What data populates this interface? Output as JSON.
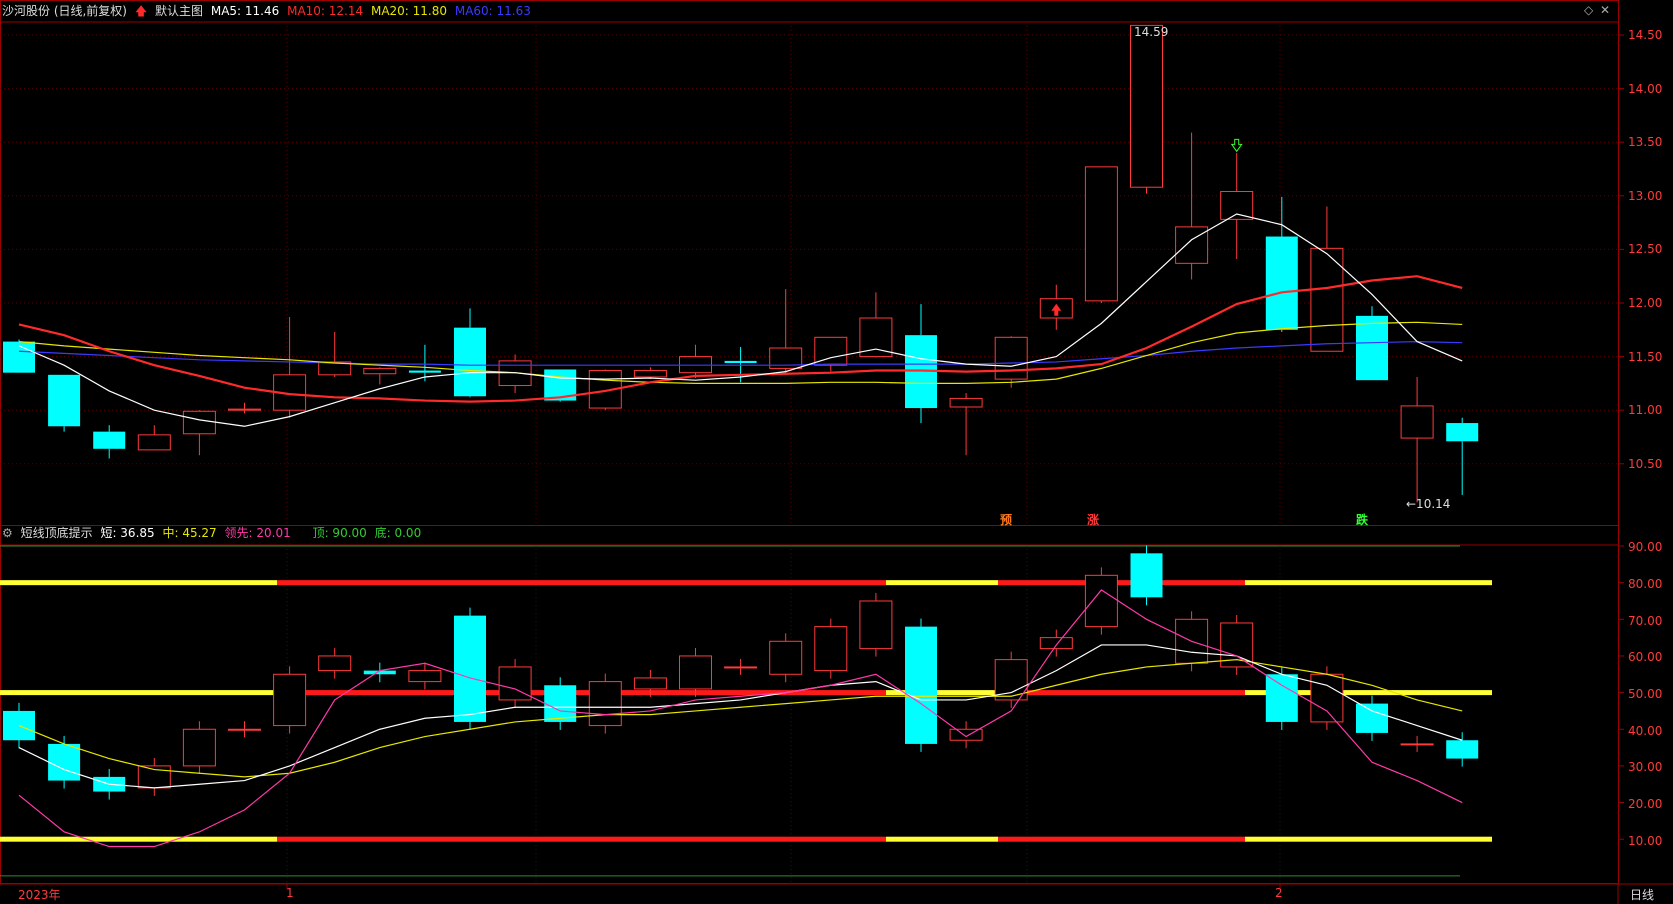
{
  "main_panel": {
    "stock_label": "沙河股份 (日线,前复权)",
    "arrow_icon": "red-up-arrow",
    "template_label": "默认主图",
    "ma": [
      {
        "label": "MA5: 11.46",
        "color": "#ffffff"
      },
      {
        "label": "MA10: 12.14",
        "color": "#ff2a2a"
      },
      {
        "label": "MA20: 11.80",
        "color": "#e6e600"
      },
      {
        "label": "MA60: 11.63",
        "color": "#3a3aff"
      }
    ],
    "high_label": "14.59",
    "low_label": "←10.14",
    "markers": [
      {
        "text": "预",
        "color": "#ff7a1a"
      },
      {
        "text": "涨",
        "color": "#ff3a3a"
      },
      {
        "text": "跌",
        "color": "#33ff33"
      }
    ],
    "y_ticks": [
      "14.50",
      "14.00",
      "13.50",
      "13.00",
      "12.50",
      "12.00",
      "11.50",
      "11.00",
      "10.50"
    ]
  },
  "sub_panel": {
    "indicator_label": "短线顶底提示",
    "values": [
      {
        "label": "短: 36.85",
        "color": "#ffffff"
      },
      {
        "label": "中: 45.27",
        "color": "#e6e600"
      },
      {
        "label": "领先: 20.01",
        "color": "#ff3aa8"
      },
      {
        "label": "顶: 90.00",
        "color": "#33cc33"
      },
      {
        "label": "底: 0.00",
        "color": "#33cc33"
      }
    ],
    "y_ticks": [
      "90.00",
      "80.00",
      "70.00",
      "60.00",
      "50.00",
      "40.00",
      "30.00",
      "20.00",
      "10.00"
    ]
  },
  "x_axis": {
    "labels": [
      "2023年",
      "1",
      "2"
    ],
    "period_button": "日线"
  },
  "colors": {
    "up": "#ff3a3a",
    "down": "#00ffff",
    "ma5": "#ffffff",
    "ma10": "#ff2a2a",
    "ma20": "#e6e600",
    "ma60": "#3a3aff",
    "grid": "#5a0000",
    "border": "#9a0000"
  },
  "candles": [
    {
      "o": 11.64,
      "h": 11.66,
      "l": 11.35,
      "c": 11.35
    },
    {
      "o": 11.33,
      "h": 11.33,
      "l": 10.8,
      "c": 10.85
    },
    {
      "o": 10.8,
      "h": 10.86,
      "l": 10.55,
      "c": 10.64
    },
    {
      "o": 10.63,
      "h": 10.86,
      "l": 10.63,
      "c": 10.77
    },
    {
      "o": 10.78,
      "h": 11.0,
      "l": 10.58,
      "c": 10.99
    },
    {
      "o": 11.0,
      "h": 11.07,
      "l": 10.97,
      "c": 11.01
    },
    {
      "o": 11.0,
      "h": 11.87,
      "l": 10.93,
      "c": 11.33
    },
    {
      "o": 11.33,
      "h": 11.73,
      "l": 11.31,
      "c": 11.45
    },
    {
      "o": 11.34,
      "h": 11.4,
      "l": 11.24,
      "c": 11.39
    },
    {
      "o": 11.37,
      "h": 11.61,
      "l": 11.27,
      "c": 11.35
    },
    {
      "o": 11.77,
      "h": 11.95,
      "l": 11.12,
      "c": 11.13
    },
    {
      "o": 11.23,
      "h": 11.52,
      "l": 11.16,
      "c": 11.46
    },
    {
      "o": 11.38,
      "h": 11.38,
      "l": 11.08,
      "c": 11.09
    },
    {
      "o": 11.02,
      "h": 11.38,
      "l": 11.0,
      "c": 11.37
    },
    {
      "o": 11.31,
      "h": 11.4,
      "l": 11.29,
      "c": 11.37
    },
    {
      "o": 11.35,
      "h": 11.61,
      "l": 11.3,
      "c": 11.5
    },
    {
      "o": 11.46,
      "h": 11.59,
      "l": 11.26,
      "c": 11.44
    },
    {
      "o": 11.39,
      "h": 12.13,
      "l": 11.33,
      "c": 11.58
    },
    {
      "o": 11.42,
      "h": 11.58,
      "l": 11.36,
      "c": 11.68
    },
    {
      "o": 11.5,
      "h": 12.1,
      "l": 11.49,
      "c": 11.86
    },
    {
      "o": 11.7,
      "h": 11.99,
      "l": 10.88,
      "c": 11.02
    },
    {
      "o": 11.03,
      "h": 11.16,
      "l": 10.58,
      "c": 11.11
    },
    {
      "o": 11.29,
      "h": 11.69,
      "l": 11.21,
      "c": 11.68
    },
    {
      "o": 11.86,
      "h": 12.17,
      "l": 11.75,
      "c": 12.04
    },
    {
      "o": 12.02,
      "h": 13.27,
      "l": 12.0,
      "c": 13.27
    },
    {
      "o": 13.08,
      "h": 14.59,
      "l": 13.02,
      "c": 14.59
    },
    {
      "o": 12.37,
      "h": 13.59,
      "l": 12.22,
      "c": 12.71
    },
    {
      "o": 12.78,
      "h": 13.4,
      "l": 12.41,
      "c": 13.04
    },
    {
      "o": 12.62,
      "h": 12.99,
      "l": 11.73,
      "c": 11.75
    },
    {
      "o": 11.55,
      "h": 12.9,
      "l": 11.55,
      "c": 12.51
    },
    {
      "o": 11.88,
      "h": 11.97,
      "l": 11.28,
      "c": 11.28
    },
    {
      "o": 10.74,
      "h": 11.31,
      "l": 10.14,
      "c": 11.04
    },
    {
      "o": 10.88,
      "h": 10.93,
      "l": 10.21,
      "c": 10.71
    }
  ],
  "ma_lines": {
    "ma5": [
      11.6,
      11.42,
      11.18,
      11.0,
      10.91,
      10.85,
      10.94,
      11.07,
      11.2,
      11.31,
      11.35,
      11.35,
      11.3,
      11.29,
      11.3,
      11.28,
      11.31,
      11.36,
      11.49,
      11.57,
      11.48,
      11.43,
      11.41,
      11.5,
      11.81,
      12.2,
      12.59,
      12.83,
      12.73,
      12.46,
      12.08,
      11.64,
      11.46
    ],
    "ma10": [
      11.8,
      11.7,
      11.55,
      11.42,
      11.32,
      11.21,
      11.15,
      11.12,
      11.11,
      11.09,
      11.08,
      11.09,
      11.12,
      11.18,
      11.26,
      11.32,
      11.33,
      11.34,
      11.35,
      11.37,
      11.37,
      11.36,
      11.37,
      11.39,
      11.43,
      11.58,
      11.78,
      11.99,
      12.1,
      12.14,
      12.21,
      12.25,
      12.14
    ],
    "ma20": [
      11.64,
      11.6,
      11.57,
      11.54,
      11.51,
      11.49,
      11.47,
      11.44,
      11.42,
      11.4,
      11.37,
      11.35,
      11.31,
      11.28,
      11.26,
      11.25,
      11.25,
      11.25,
      11.26,
      11.26,
      11.25,
      11.25,
      11.26,
      11.29,
      11.39,
      11.51,
      11.63,
      11.72,
      11.76,
      11.79,
      11.81,
      11.82,
      11.8
    ],
    "ma60": [
      11.55,
      11.53,
      11.51,
      11.49,
      11.47,
      11.46,
      11.45,
      11.44,
      11.43,
      11.43,
      11.42,
      11.42,
      11.42,
      11.42,
      11.42,
      11.42,
      11.42,
      11.42,
      11.43,
      11.43,
      11.43,
      11.43,
      11.44,
      11.45,
      11.48,
      11.51,
      11.55,
      11.58,
      11.6,
      11.62,
      11.63,
      11.64,
      11.63
    ]
  },
  "osc_candles": [
    {
      "o": 45,
      "c": 37
    },
    {
      "o": 36,
      "c": 26
    },
    {
      "o": 27,
      "c": 23
    },
    {
      "o": 24,
      "c": 30
    },
    {
      "o": 30,
      "c": 40
    },
    {
      "o": 40,
      "c": 40
    },
    {
      "o": 41,
      "c": 55
    },
    {
      "o": 56,
      "c": 60
    },
    {
      "o": 56,
      "c": 55
    },
    {
      "o": 53,
      "c": 56
    },
    {
      "o": 71,
      "c": 42
    },
    {
      "o": 48,
      "c": 57
    },
    {
      "o": 52,
      "c": 42
    },
    {
      "o": 41,
      "c": 53
    },
    {
      "o": 51,
      "c": 54
    },
    {
      "o": 51,
      "c": 60
    },
    {
      "o": 57,
      "c": 57
    },
    {
      "o": 55,
      "c": 64
    },
    {
      "o": 56,
      "c": 68
    },
    {
      "o": 62,
      "c": 75
    },
    {
      "o": 68,
      "c": 36
    },
    {
      "o": 37,
      "c": 40
    },
    {
      "o": 48,
      "c": 59
    },
    {
      "o": 62,
      "c": 65
    },
    {
      "o": 68,
      "c": 82
    },
    {
      "o": 88,
      "c": 76
    },
    {
      "o": 58,
      "c": 70
    },
    {
      "o": 57,
      "c": 69
    },
    {
      "o": 55,
      "c": 42
    },
    {
      "o": 42,
      "c": 55
    },
    {
      "o": 47,
      "c": 39
    },
    {
      "o": 36,
      "c": 36
    },
    {
      "o": 37,
      "c": 32
    }
  ],
  "osc_lines": {
    "short": [
      35,
      29,
      25,
      24,
      25,
      26,
      30,
      35,
      40,
      43,
      44,
      46,
      46,
      46,
      46,
      47,
      48,
      50,
      52,
      53,
      48,
      48,
      50,
      56,
      63,
      63,
      61,
      60,
      55,
      52,
      45,
      41,
      37
    ],
    "mid": [
      41,
      36,
      32,
      29,
      28,
      27,
      28,
      31,
      35,
      38,
      40,
      42,
      43,
      44,
      44,
      45,
      46,
      47,
      48,
      49,
      49,
      49,
      49,
      52,
      55,
      57,
      58,
      59,
      57,
      55,
      52,
      48,
      45
    ],
    "lead": [
      22,
      12,
      8,
      8,
      12,
      18,
      28,
      48,
      56,
      58,
      54,
      51,
      45,
      44,
      45,
      48,
      49,
      50,
      52,
      55,
      47,
      38,
      45,
      63,
      78,
      70,
      64,
      60,
      52,
      45,
      31,
      26,
      20
    ]
  }
}
